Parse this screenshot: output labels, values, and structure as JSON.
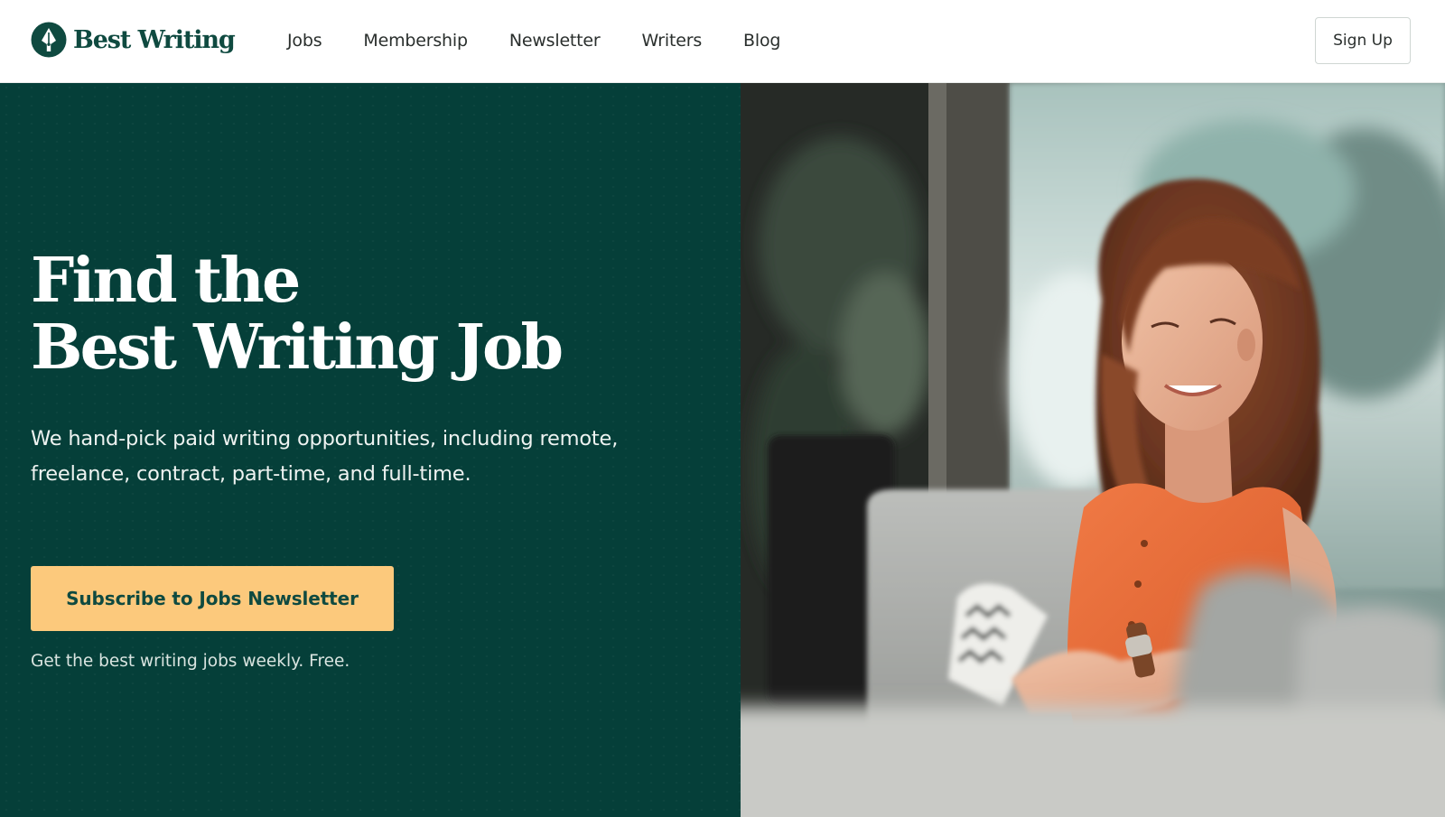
{
  "brand": {
    "name": "Best Writing",
    "logo_icon": "pen-nib-icon",
    "color": "#0f4a40"
  },
  "nav": {
    "items": [
      {
        "label": "Jobs"
      },
      {
        "label": "Membership"
      },
      {
        "label": "Newsletter"
      },
      {
        "label": "Writers"
      },
      {
        "label": "Blog"
      }
    ],
    "signup_label": "Sign Up"
  },
  "hero": {
    "title_line1": "Find the",
    "title_line2": "Best Writing Job",
    "subtitle": "We hand-pick paid writing opportunities, including remote, freelance, contract, part-time, and full-time.",
    "cta_label": "Subscribe to Jobs Newsletter",
    "cta_note": "Get the best writing jobs weekly. Free.",
    "background_color": "#053f39",
    "cta_color": "#fcc97c",
    "image_subject": "smiling woman in orange top working on a laptop on a grey sofa"
  }
}
